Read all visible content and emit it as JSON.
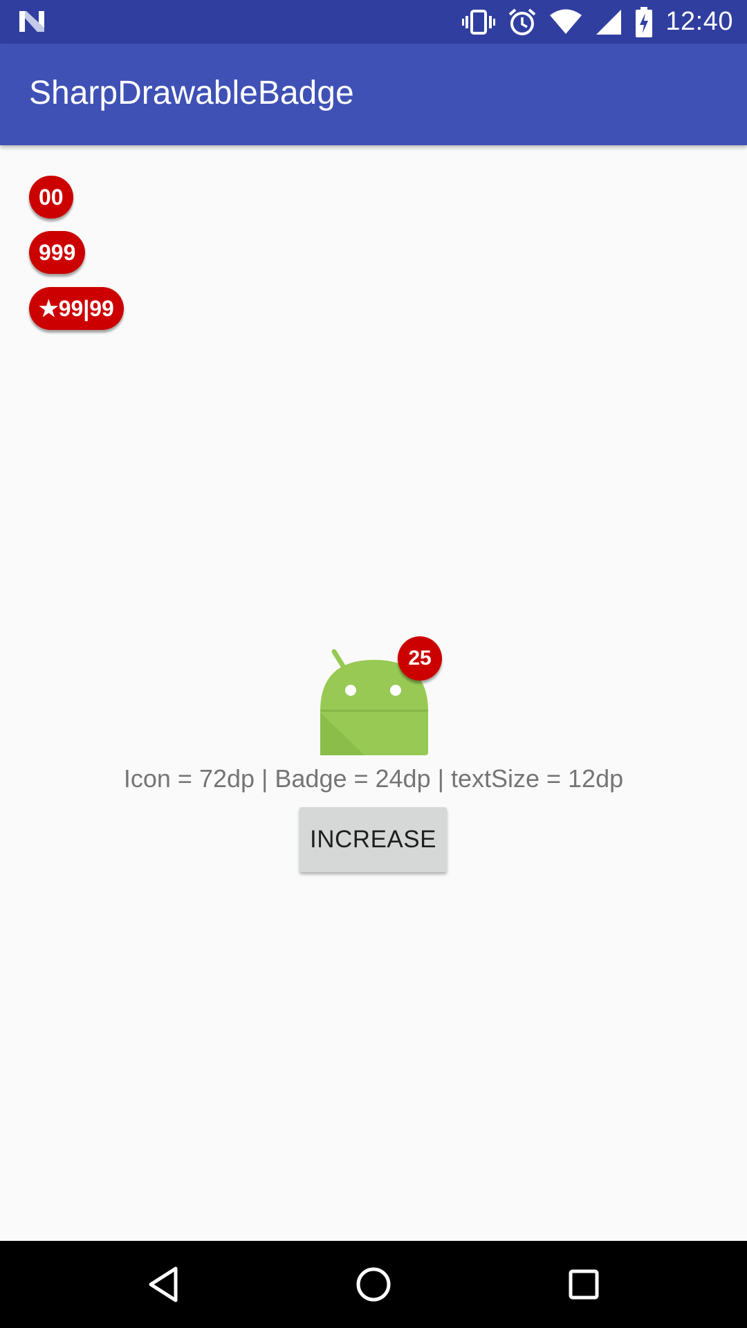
{
  "status_bar": {
    "time": "12:40",
    "icons": [
      "n-logo-icon",
      "vibrate-icon",
      "alarm-icon",
      "wifi-icon",
      "signal-icon",
      "battery-charging-icon"
    ],
    "background": "#303f9f"
  },
  "app_bar": {
    "title": "SharpDrawableBadge",
    "background": "#3f51b5"
  },
  "badges": [
    {
      "text": "00"
    },
    {
      "text": "999"
    },
    {
      "text": "★99|99"
    }
  ],
  "badge_color": "#cc0000",
  "android_icon": {
    "icon": "android-icon",
    "badge": "25"
  },
  "caption": "Icon = 72dp | Badge = 24dp | textSize = 12dp",
  "increase_button": {
    "label": "INCREASE"
  },
  "nav_bar": {
    "buttons": [
      "back-icon",
      "home-icon",
      "recents-icon"
    ]
  }
}
